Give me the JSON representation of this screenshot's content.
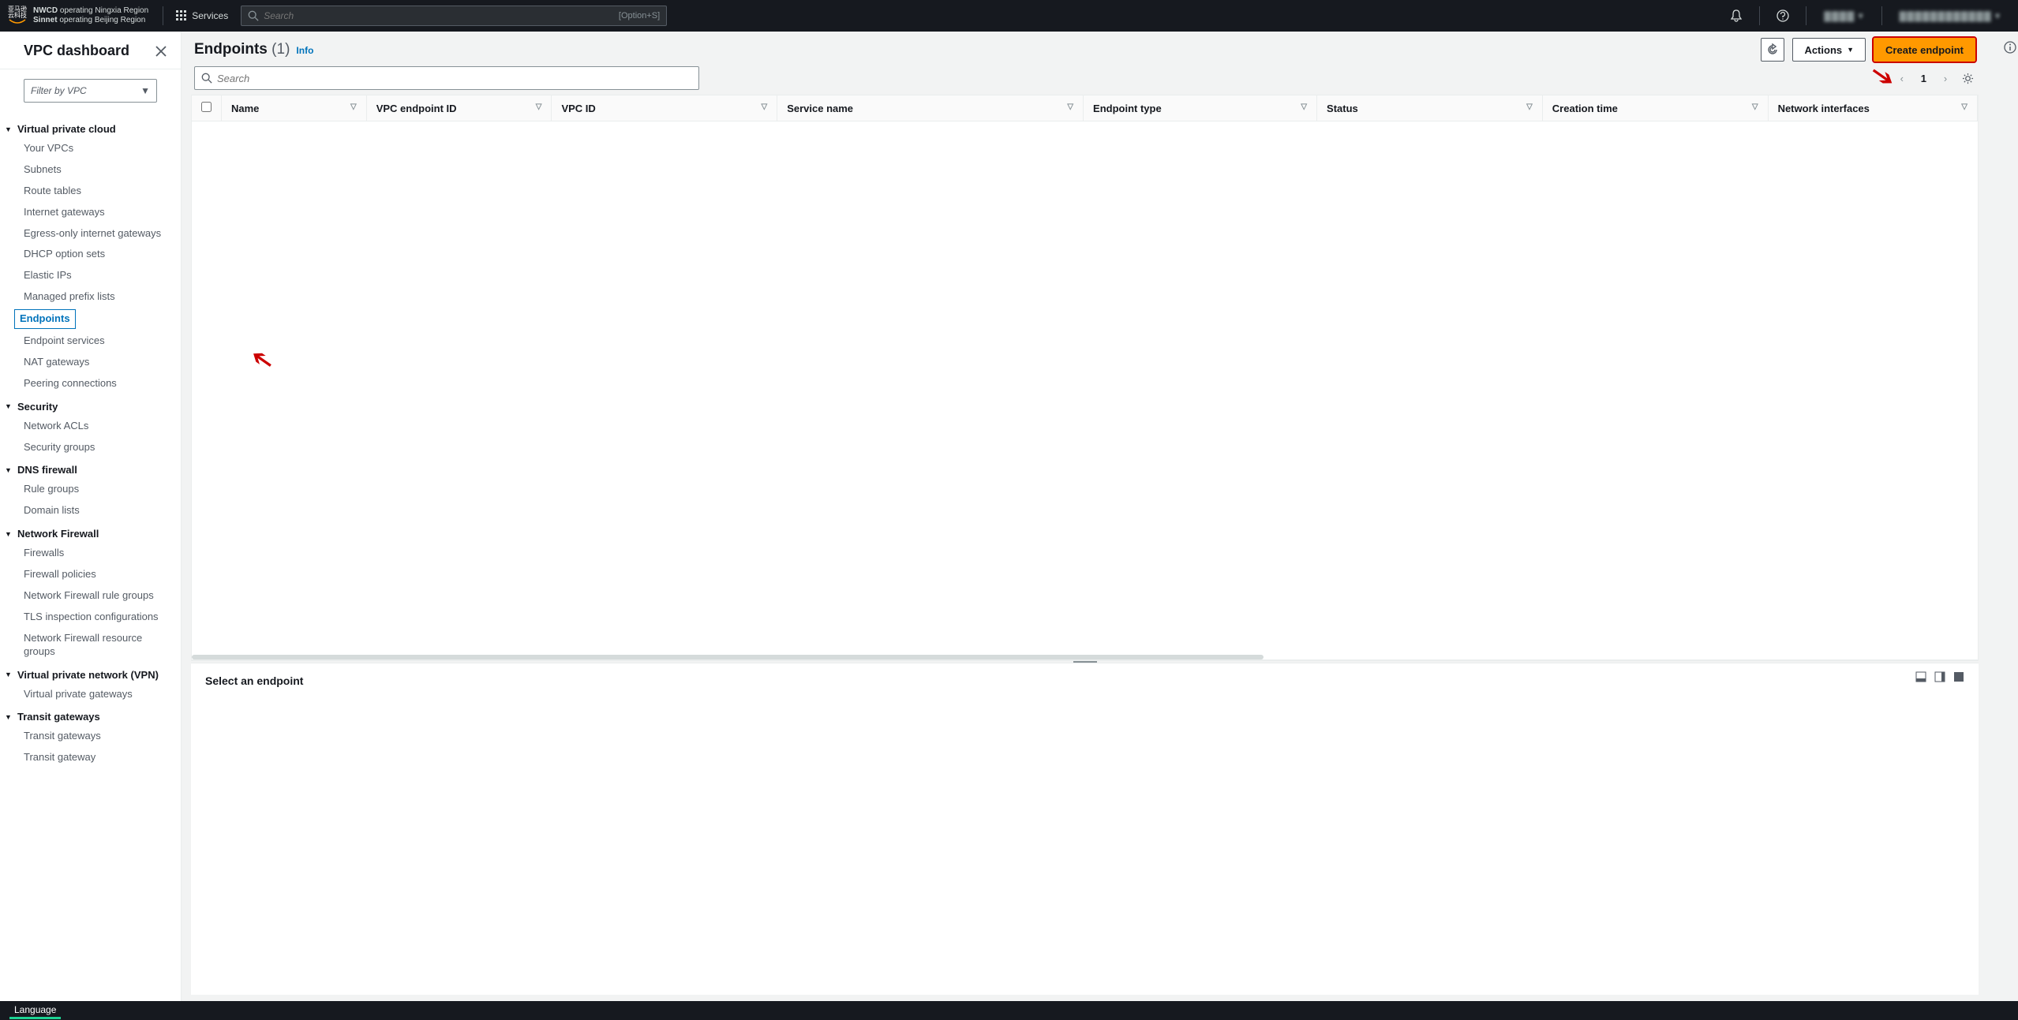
{
  "topnav": {
    "logo_text": "亚马逊云科技",
    "region_line1_b": "NWCD",
    "region_line1": " operating Ningxia Region",
    "region_line2_b": "Sinnet",
    "region_line2": " operating Beijing Region",
    "services": "Services",
    "search_placeholder": "Search",
    "shortcut": "[Option+S]",
    "region_selector": "▓▓▓▓ ▾",
    "account": "▓▓▓▓▓▓▓▓▓▓▓▓ ▾"
  },
  "sidebar": {
    "title": "VPC dashboard",
    "filter_placeholder": "Filter by VPC",
    "sections": [
      {
        "label": "Virtual private cloud",
        "items": [
          "Your VPCs",
          "Subnets",
          "Route tables",
          "Internet gateways",
          "Egress-only internet gateways",
          "DHCP option sets",
          "Elastic IPs",
          "Managed prefix lists",
          "Endpoints",
          "Endpoint services",
          "NAT gateways",
          "Peering connections"
        ],
        "active_index": 8
      },
      {
        "label": "Security",
        "items": [
          "Network ACLs",
          "Security groups"
        ]
      },
      {
        "label": "DNS firewall",
        "items": [
          "Rule groups",
          "Domain lists"
        ]
      },
      {
        "label": "Network Firewall",
        "items": [
          "Firewalls",
          "Firewall policies",
          "Network Firewall rule groups",
          "TLS inspection configurations",
          "Network Firewall resource groups"
        ]
      },
      {
        "label": "Virtual private network (VPN)",
        "items": [
          "Virtual private gateways"
        ]
      },
      {
        "label": "Transit gateways",
        "items": [
          "Transit gateways",
          "Transit gateway"
        ]
      }
    ]
  },
  "main": {
    "title": "Endpoints",
    "count": "(1)",
    "info": "Info",
    "actions_label": "Actions",
    "create_label": "Create endpoint",
    "search_placeholder": "Search",
    "page_current": "1",
    "columns": [
      "Name",
      "VPC endpoint ID",
      "VPC ID",
      "Service name",
      "Endpoint type",
      "Status",
      "Creation time",
      "Network interfaces"
    ],
    "details_title": "Select an endpoint"
  },
  "bottom": {
    "language": "Language"
  }
}
